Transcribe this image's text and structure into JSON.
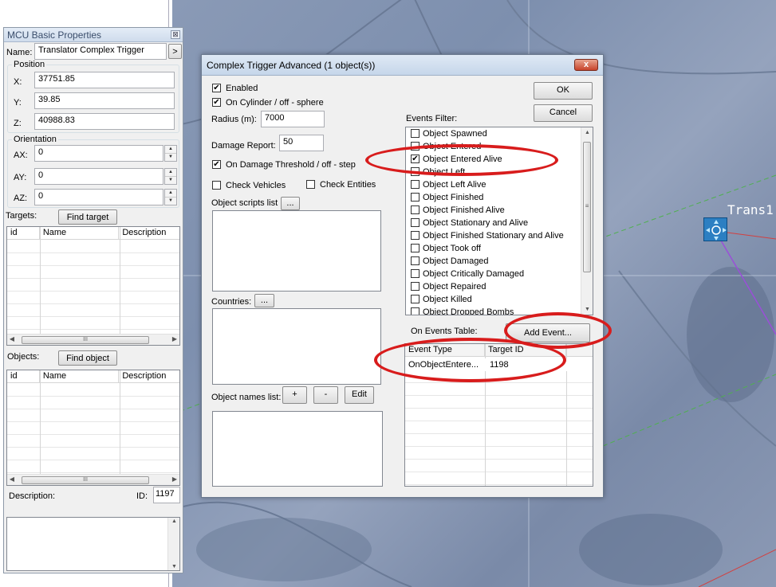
{
  "map": {
    "label": "Trans1"
  },
  "mcu": {
    "title": "MCU Basic Properties",
    "name_label": "Name:",
    "name_value": "Translator Complex Trigger",
    "name_btn": ">",
    "position_label": "Position",
    "x_label": "X:",
    "x_value": "37751.85",
    "y_label": "Y:",
    "y_value": "39.85",
    "z_label": "Z:",
    "z_value": "40988.83",
    "orientation_label": "Orientation",
    "ax_label": "AX:",
    "ax_value": "0",
    "ay_label": "AY:",
    "ay_value": "0",
    "az_label": "AZ:",
    "az_value": "0",
    "targets_label": "Targets:",
    "find_target": "Find target",
    "objects_label": "Objects:",
    "find_object": "Find object",
    "columns": [
      "id",
      "Name",
      "Description"
    ],
    "scroll_thumb": "III",
    "description_label": "Description:",
    "id_label": "ID:",
    "id_value": "1197"
  },
  "dialog": {
    "title": "Complex Trigger Advanced (1 object(s))",
    "close": "x",
    "ok": "OK",
    "cancel": "Cancel",
    "enabled": "Enabled",
    "on_cylinder": "On Cylinder / off - sphere",
    "radius_label": "Radius (m):",
    "radius_value": "7000",
    "damage_report_label": "Damage Report:",
    "damage_report_value": "50",
    "on_damage": "On Damage Threshold / off - step",
    "check_vehicles": "Check Vehicles",
    "check_entities": "Check Entities",
    "scripts_label": "Object scripts list",
    "dots": "...",
    "countries_label": "Countries:",
    "names_label": "Object names list:",
    "plus": "+",
    "minus": "-",
    "edit": "Edit",
    "events_filter_label": "Events Filter:",
    "events": [
      {
        "label": "Object Spawned",
        "checked": false
      },
      {
        "label": "Object Entered",
        "checked": false
      },
      {
        "label": "Object Entered Alive",
        "checked": true
      },
      {
        "label": "Object Left",
        "checked": false
      },
      {
        "label": "Object Left Alive",
        "checked": false
      },
      {
        "label": "Object Finished",
        "checked": false
      },
      {
        "label": "Object Finished Alive",
        "checked": false
      },
      {
        "label": "Object Stationary and Alive",
        "checked": false
      },
      {
        "label": "Object Finished Stationary and Alive",
        "checked": false
      },
      {
        "label": "Object Took off",
        "checked": false
      },
      {
        "label": "Object Damaged",
        "checked": false
      },
      {
        "label": "Object Critically Damaged",
        "checked": false
      },
      {
        "label": "Object Repaired",
        "checked": false
      },
      {
        "label": "Object Killed",
        "checked": false
      },
      {
        "label": "Object Dropped Bombs",
        "checked": false
      }
    ],
    "on_events_table_label": "On Events Table:",
    "add_event": "Add Event...",
    "table_columns": [
      "Event Type",
      "Target ID"
    ],
    "table_rows": [
      {
        "event_type": "OnObjectEntere...",
        "target_id": "1198"
      }
    ],
    "scroll_grip": "≡"
  },
  "colors": {
    "highlight_oval": "#d81c1c",
    "map_base": "#8a9ab6"
  }
}
